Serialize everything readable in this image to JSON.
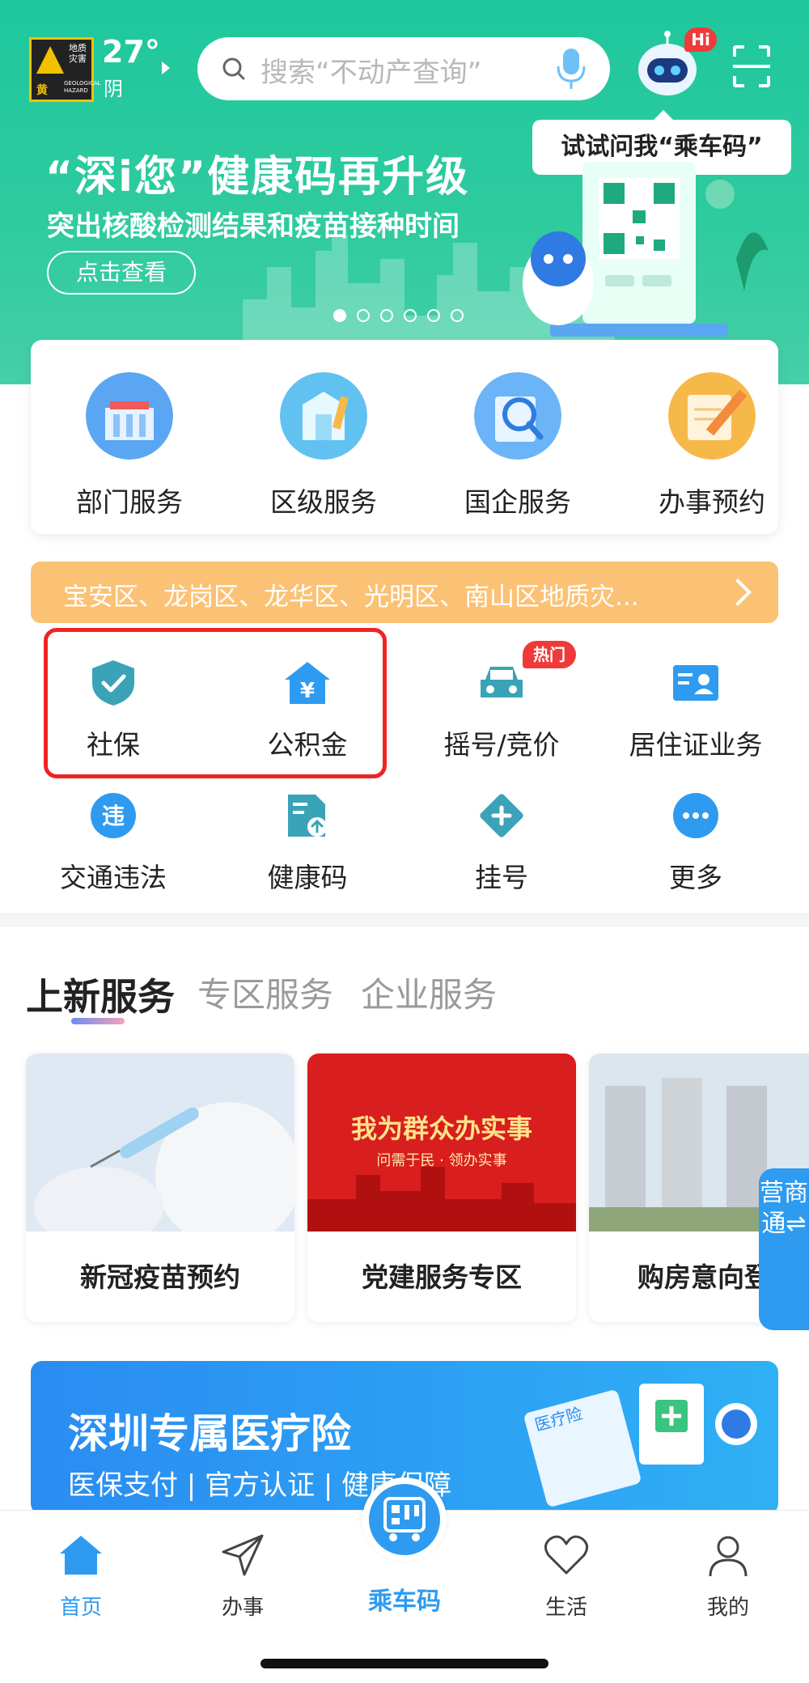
{
  "header": {
    "weather": {
      "badge_text": "地质灾害",
      "badge_level": "黄",
      "badge_sub": "GEOLOGICAL HAZARD",
      "temperature": "27°",
      "condition": "阴"
    },
    "search_placeholder": "搜索“不动产查询”",
    "robot_badge": "Hi",
    "ask_tip": "试试问我“乘车码”"
  },
  "banner": {
    "title": "“深i您”健康码再升级",
    "subtitle": "突出核酸检测结果和疫苗接种时间",
    "button": "点击查看",
    "dots_count": 6,
    "active_dot": 0
  },
  "services": [
    {
      "label": "部门服务",
      "icon": "government-building-icon",
      "color": "#5aa6f2"
    },
    {
      "label": "区级服务",
      "icon": "district-building-icon",
      "color": "#61c1f0"
    },
    {
      "label": "国企服务",
      "icon": "magnifier-doc-icon",
      "color": "#6ab4f7"
    },
    {
      "label": "办事预约",
      "icon": "appointment-pencil-icon",
      "color": "#f7b84a"
    }
  ],
  "notice": {
    "text": "宝安区、龙岗区、龙华区、光明区、南山区地质灾..."
  },
  "quick": [
    {
      "label": "社保",
      "icon": "shield-check-icon",
      "color": "#3aa3b7"
    },
    {
      "label": "公积金",
      "icon": "house-yuan-icon",
      "color": "#2e9bf0"
    },
    {
      "label": "摇号/竞价",
      "icon": "car-icon",
      "color": "#3aa3b7"
    },
    {
      "label": "居住证业务",
      "icon": "id-card-icon",
      "color": "#2e9bf0"
    },
    {
      "label": "交通违法",
      "icon": "violation-circle-icon",
      "color": "#2e9bf0"
    },
    {
      "label": "健康码",
      "icon": "health-doc-icon",
      "color": "#3aa3b7"
    },
    {
      "label": "挂号",
      "icon": "plus-diamond-icon",
      "color": "#3aa3b7"
    },
    {
      "label": "更多",
      "icon": "more-dots-icon",
      "color": "#2e9bf0"
    }
  ],
  "hot_badge": "热门",
  "tabs": [
    "上新服务",
    "专区服务",
    "企业服务"
  ],
  "new_services": [
    {
      "label": "新冠疫苗预约",
      "image": "vaccine-photo"
    },
    {
      "label": "党建服务专区",
      "image": "party-red-banner",
      "image_title": "我为群众办实事",
      "image_sub": "问需于民 · 领办实事"
    },
    {
      "label": "购房意向登",
      "image": "apartment-photo"
    }
  ],
  "side_tab": "营商通⇌",
  "insurance": {
    "title": "深圳专属医疗险",
    "subtitle": "医保支付 | 官方认证 | 健康保障",
    "card_text": "医疗险"
  },
  "bottom_nav": [
    {
      "label": "首页",
      "icon": "home-icon",
      "active": true
    },
    {
      "label": "办事",
      "icon": "paper-plane-icon",
      "active": false
    },
    {
      "label": "乘车码",
      "icon": "bus-qr-icon",
      "active": false
    },
    {
      "label": "生活",
      "icon": "heart-icon",
      "active": false
    },
    {
      "label": "我的",
      "icon": "user-icon",
      "active": false
    }
  ]
}
